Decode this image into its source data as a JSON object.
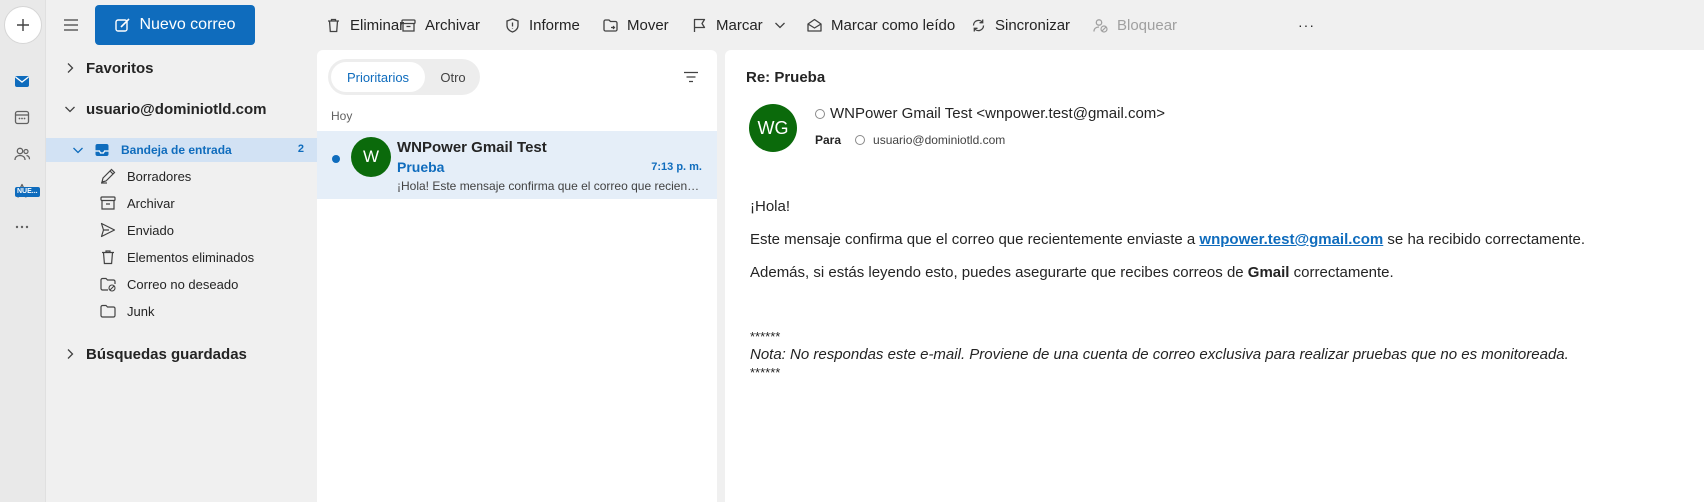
{
  "rail": {
    "badge": "NUE..."
  },
  "toolbar": {
    "new_mail": "Nuevo correo",
    "delete": "Eliminar",
    "archive": "Archivar",
    "report": "Informe",
    "move": "Mover",
    "flag": "Marcar",
    "mark_read": "Marcar como leído",
    "sync": "Sincronizar",
    "block": "Bloquear",
    "more": "···"
  },
  "nav": {
    "favorites": "Favoritos",
    "account": "usuario@dominiotld.com",
    "inbox": {
      "label": "Bandeja de entrada",
      "count": "2"
    },
    "folders": [
      {
        "label": "Borradores",
        "icon": "draft-icon"
      },
      {
        "label": "Archivar",
        "icon": "archive-icon"
      },
      {
        "label": "Enviado",
        "icon": "send-icon"
      },
      {
        "label": "Elementos eliminados",
        "icon": "delete-icon"
      },
      {
        "label": "Correo no deseado",
        "icon": "junk-icon"
      },
      {
        "label": "Junk",
        "icon": "folder-icon"
      }
    ],
    "saved_searches": "Búsquedas guardadas"
  },
  "list": {
    "tab_focused": "Prioritarios",
    "tab_other": "Otro",
    "group": "Hoy",
    "message": {
      "avatar": "W",
      "from": "WNPower Gmail Test",
      "subject": "Prueba",
      "time": "7:13 p. m.",
      "preview": "¡Hola! Este mensaje confirma que el correo que recientemente enviaste a wnpower.test@gmail.com se ha recibido correctamente."
    }
  },
  "reading": {
    "subject": "Re: Prueba",
    "avatar": "WG",
    "from": "WNPower Gmail Test <wnpower.test@gmail.com>",
    "to_label": "Para",
    "to": "usuario@dominiotld.com",
    "greeting": "¡Hola!",
    "line1_a": "Este mensaje confirma que el correo que recientemente enviaste a ",
    "line1_link": "wnpower.test@gmail.com",
    "line1_b": " se ha recibido correctamente.",
    "line2_a": "Además, si estás leyendo esto, puedes asegurarte que recibes correos de ",
    "line2_bold": "Gmail",
    "line2_b": " correctamente.",
    "stars1": "******",
    "note": "Nota: No respondas este e-mail. Proviene de una cuenta de correo exclusiva para realizar pruebas que no es monitoreada.",
    "stars2": "******"
  },
  "colors": {
    "accent": "#0f6cbd",
    "avatar": "#0b6a0b",
    "selected": "#d2e2f4"
  }
}
